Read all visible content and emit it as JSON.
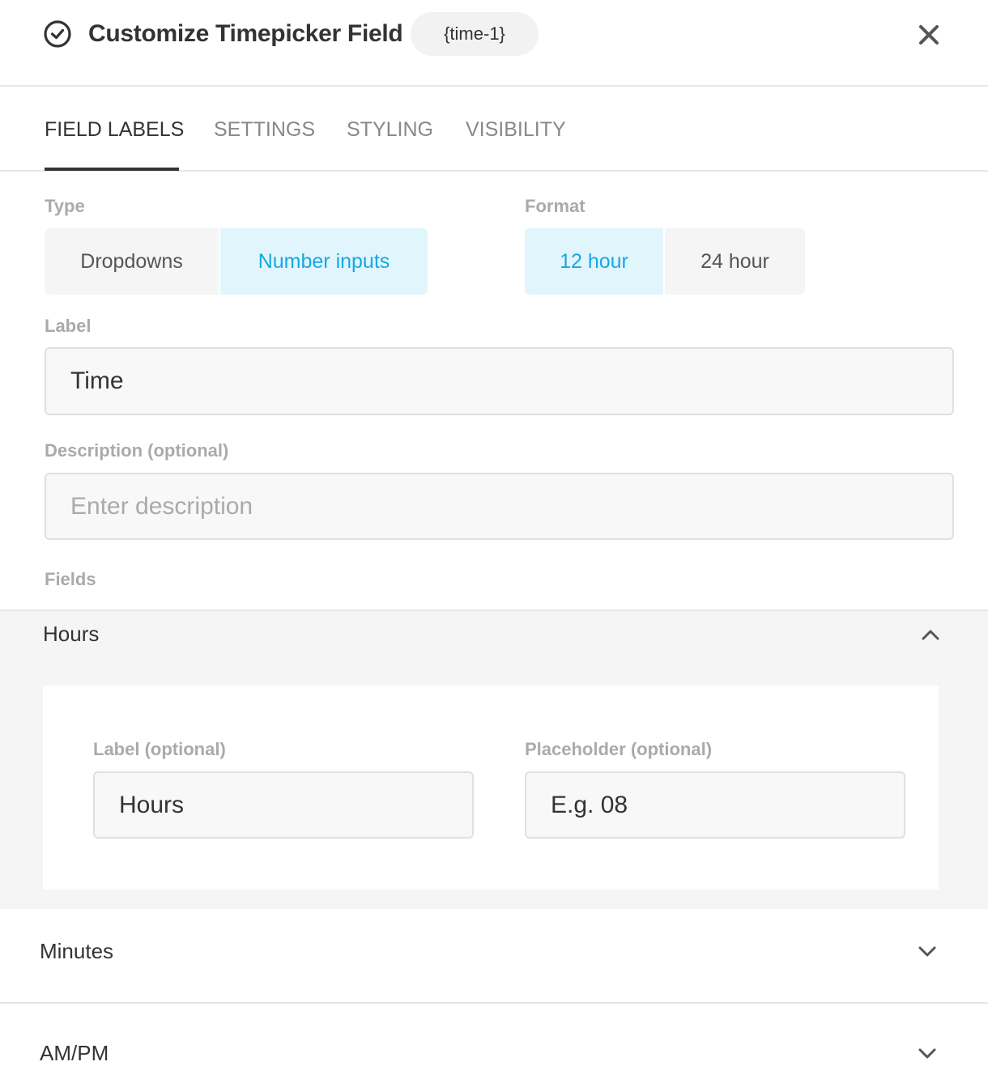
{
  "header": {
    "title": "Customize Timepicker Field",
    "tag": "{time-1}",
    "icons": {
      "title": "clock-icon",
      "close": "close-icon"
    }
  },
  "tabs": [
    {
      "label": "FIELD LABELS",
      "active": true
    },
    {
      "label": "SETTINGS",
      "active": false
    },
    {
      "label": "STYLING",
      "active": false
    },
    {
      "label": "VISIBILITY",
      "active": false
    }
  ],
  "type_group": {
    "label": "Type",
    "options": [
      {
        "label": "Dropdowns",
        "selected": false
      },
      {
        "label": "Number inputs",
        "selected": true
      }
    ]
  },
  "format_group": {
    "label": "Format",
    "options": [
      {
        "label": "12 hour",
        "selected": true
      },
      {
        "label": "24 hour",
        "selected": false
      }
    ]
  },
  "label_field": {
    "label": "Label",
    "value": "Time"
  },
  "description_field": {
    "label": "Description (optional)",
    "value": "",
    "placeholder": "Enter description"
  },
  "fields_section": {
    "label": "Fields",
    "hours": {
      "title": "Hours",
      "expanded": true,
      "label_field": {
        "label": "Label (optional)",
        "value": "Hours"
      },
      "placeholder_field": {
        "label": "Placeholder (optional)",
        "value": "E.g. 08"
      }
    },
    "minutes": {
      "title": "Minutes",
      "expanded": false
    },
    "ampm": {
      "title": "AM/PM",
      "expanded": false
    }
  },
  "colors": {
    "accent": "#17a8e3",
    "accent_bg": "#e1f5fd",
    "text": "#333333",
    "muted": "#aaaaaa",
    "panel_bg": "#f5f5f5"
  }
}
